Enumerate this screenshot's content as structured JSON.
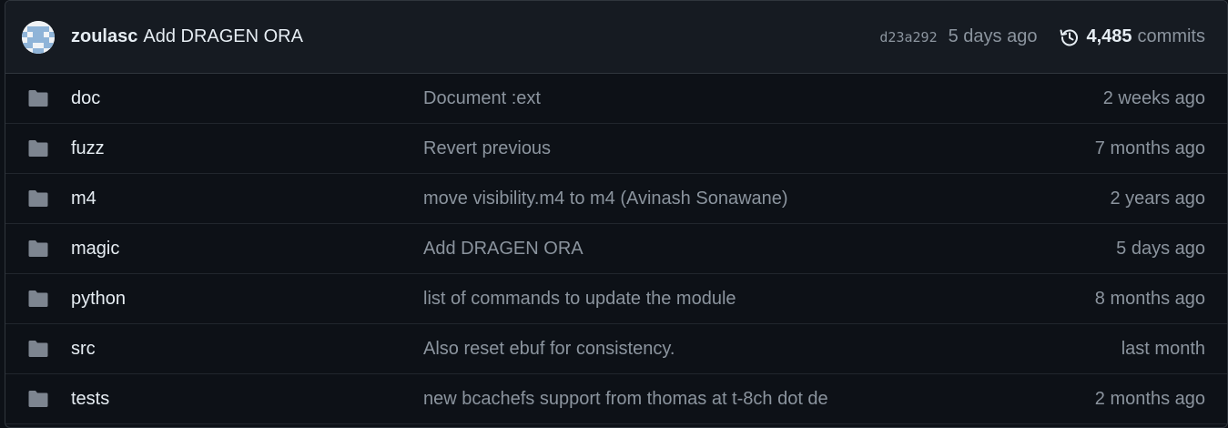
{
  "latest_commit": {
    "author": "zoulasc",
    "message": "Add DRAGEN ORA",
    "sha": "d23a292",
    "time": "5 days ago",
    "commit_count": "4,485",
    "commit_label": "commits"
  },
  "files": [
    {
      "name": "doc",
      "message": "Document :ext",
      "age": "2 weeks ago",
      "icon": "folder-icon"
    },
    {
      "name": "fuzz",
      "message": "Revert previous",
      "age": "7 months ago",
      "icon": "folder-icon"
    },
    {
      "name": "m4",
      "message": "move visibility.m4 to m4 (Avinash Sonawane)",
      "age": "2 years ago",
      "icon": "folder-icon"
    },
    {
      "name": "magic",
      "message": "Add DRAGEN ORA",
      "age": "5 days ago",
      "icon": "folder-icon"
    },
    {
      "name": "python",
      "message": "list of commands to update the module",
      "age": "8 months ago",
      "icon": "folder-icon"
    },
    {
      "name": "src",
      "message": "Also reset ebuf for consistency.",
      "age": "last month",
      "icon": "folder-icon"
    },
    {
      "name": "tests",
      "message": "new bcachefs support from thomas at t-8ch dot de",
      "age": "2 months ago",
      "icon": "folder-icon"
    }
  ],
  "colors": {
    "background": "#0d1117",
    "header_bg": "#161b22",
    "border": "#30363d",
    "folder": "#7d8590",
    "muted_text": "#8b949e",
    "text": "#e6edf3"
  }
}
